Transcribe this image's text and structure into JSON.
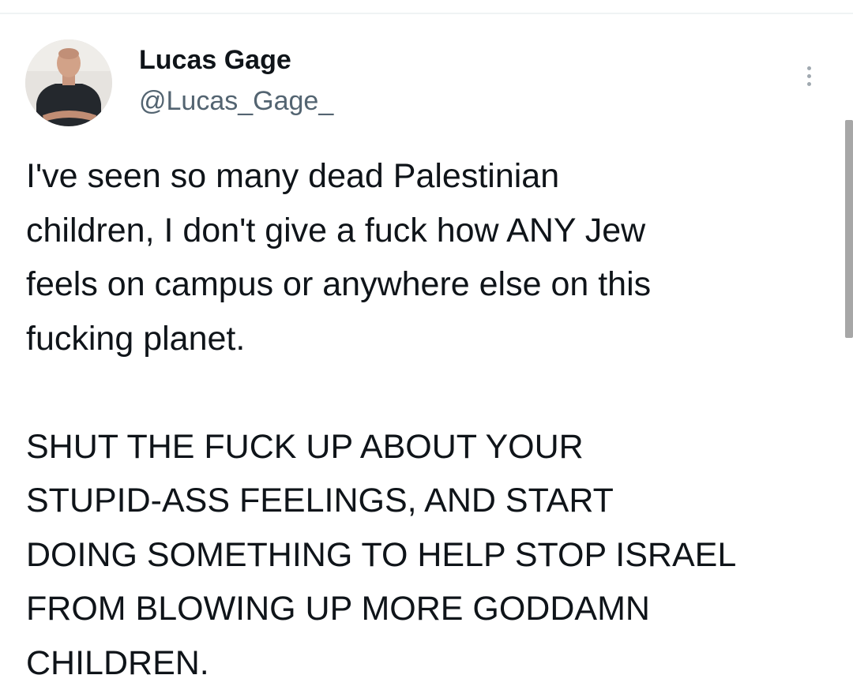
{
  "tweet": {
    "author": {
      "display_name": "Lucas Gage",
      "handle": "@Lucas_Gage_"
    },
    "text": "I've seen so many dead Palestinian\nchildren, I don't give a fuck how ANY Jew\nfeels on campus or anywhere else on this\nfucking planet.\n\nSHUT THE FUCK UP ABOUT YOUR\nSTUPID-ASS FEELINGS, AND START\nDOING SOMETHING TO HELP STOP ISRAEL\nFROM BLOWING UP MORE GODDAMN\nCHILDREN.",
    "more_icon": "vertical-ellipsis-icon"
  },
  "colors": {
    "text": "#0f1419",
    "handle": "#536471",
    "divider": "#eff3f4",
    "scrollbar": "#a7a7a7"
  }
}
